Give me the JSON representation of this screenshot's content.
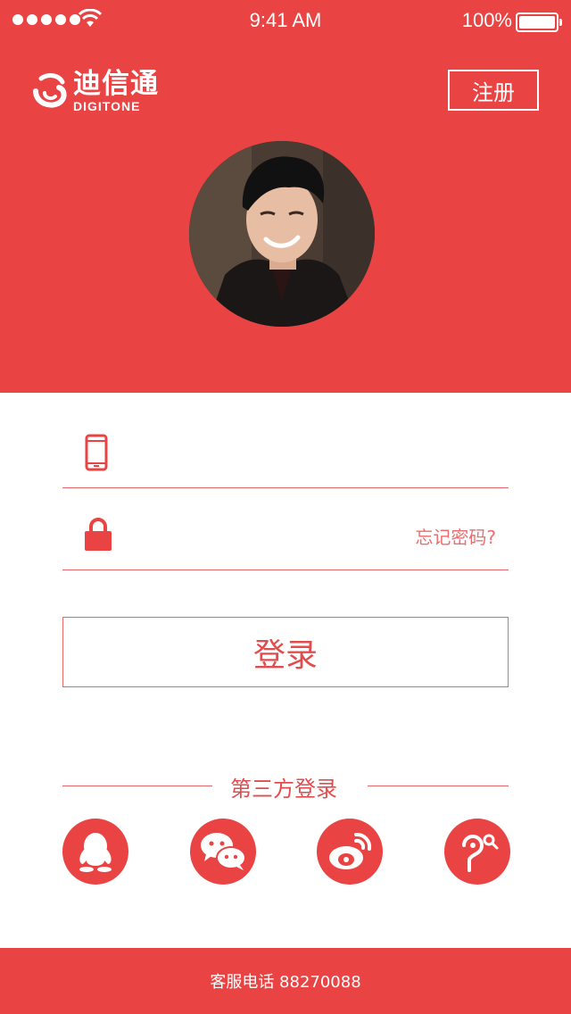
{
  "status_bar": {
    "time": "9:41 AM",
    "battery": "100%"
  },
  "header": {
    "logo_cn": "迪信通",
    "logo_en": "DIGITONE",
    "register_label": "注册"
  },
  "form": {
    "forgot_label": "忘记密码?",
    "login_label": "登录"
  },
  "third_party": {
    "title": "第三方登录",
    "providers": [
      "qq-icon",
      "wechat-icon",
      "weibo-icon",
      "pea-pod-icon"
    ]
  },
  "footer": {
    "label": "客服电话 88270088"
  },
  "colors": {
    "brand": "#ea4343",
    "accent_text": "#e14d4f"
  }
}
